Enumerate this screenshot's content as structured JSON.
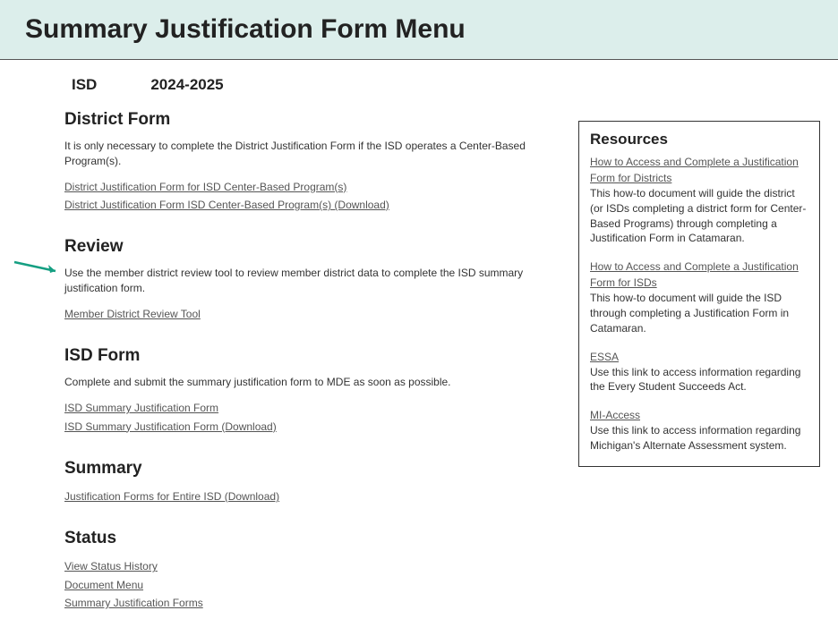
{
  "header": {
    "title": "Summary Justification Form Menu"
  },
  "breadcrumb": {
    "org": "ISD",
    "year": "2024-2025"
  },
  "sections": {
    "districtForm": {
      "heading": "District Form",
      "desc": "It is only necessary to complete the District Justification Form if the ISD operates a Center-Based Program(s).",
      "links": [
        "District Justification Form for ISD Center-Based Program(s)",
        "District Justification Form ISD Center-Based Program(s) (Download)"
      ]
    },
    "review": {
      "heading": "Review",
      "desc": "Use the member district review tool to review member district data to complete the ISD summary justification form.",
      "links": [
        "Member District Review Tool"
      ]
    },
    "isdForm": {
      "heading": "ISD Form",
      "desc": "Complete and submit the summary justification form to MDE as soon as possible.",
      "links": [
        "ISD Summary Justification Form",
        "ISD Summary Justification Form (Download)"
      ]
    },
    "summary": {
      "heading": "Summary",
      "links": [
        "Justification Forms for Entire ISD (Download)"
      ]
    },
    "status": {
      "heading": "Status",
      "links": [
        "View Status History",
        "Document Menu",
        "Summary Justification Forms"
      ]
    }
  },
  "resources": {
    "title": "Resources",
    "items": [
      {
        "link": "How to Access and Complete a Justification Form for Districts",
        "desc": "This how-to document will guide the district (or ISDs completing a district form for Center-Based Programs) through completing a Justification Form in Catamaran."
      },
      {
        "link": "How to Access and Complete a Justification Form for ISDs",
        "desc": "This how-to document will guide the ISD through completing a Justification Form in Catamaran."
      },
      {
        "link": "ESSA",
        "desc": "Use this link to access information regarding the Every Student Succeeds Act."
      },
      {
        "link": "MI-Access",
        "desc": "Use this link to access information regarding Michigan's Alternate Assessment system."
      }
    ]
  }
}
